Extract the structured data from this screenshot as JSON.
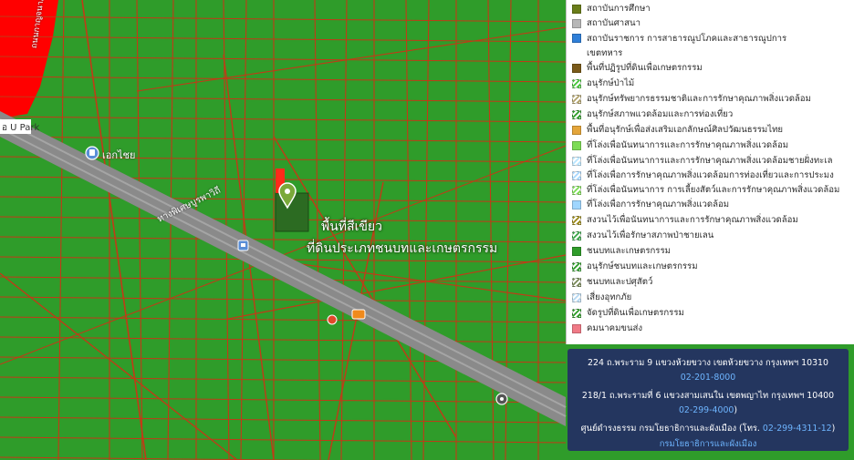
{
  "map": {
    "place_labels": {
      "park": "อ U Park",
      "poi": "เอกไชย",
      "road_main": "ทางพิเศษบูรพาวิถี",
      "road_side": "ถนนกาญจนาภิเษก"
    },
    "parcel_title": "พื้นที่สีเขียว",
    "parcel_subtitle": "ที่ดินประเภทชนบทและเกษตรกรรม",
    "colors": {
      "rural_agri": "#2f9c2a",
      "commercial": "#ff0000",
      "road": "#8a8a8a",
      "parcel_lines": "#c23a17",
      "selected_parcel": "#2c6b22"
    }
  },
  "legend": {
    "items": [
      {
        "label": "สถาบันการศึกษา",
        "color": "#6a7d1a",
        "pattern": "solid"
      },
      {
        "label": "สถาบันศาสนา",
        "color": "#b7b7b7",
        "pattern": "solid"
      },
      {
        "label": "สถาบันราชการ การสาธารณูปโภคและสาธารณูปการ เขตทหาร",
        "color": "#2f7fd8",
        "pattern": "solid"
      },
      {
        "label": "พื้นที่ปฏิรูปที่ดินเพื่อเกษตรกรรม",
        "color": "#7a5a1a",
        "pattern": "solid"
      },
      {
        "label": "อนุรักษ์ป่าไม้",
        "color": "#45c43a",
        "pattern": "hatch"
      },
      {
        "label": "อนุรักษ์ทรัพยากรธรรมชาติและการรักษาคุณภาพสิ่งแวดล้อม",
        "color": "#b2a36d",
        "pattern": "hatch"
      },
      {
        "label": "อนุรักษ์สภาพแวดล้อมและการท่องเที่ยว",
        "color": "#2f9c2a",
        "pattern": "hatch"
      },
      {
        "label": "พื้นที่อนุรักษ์เพื่อส่งเสริมเอกลักษณ์ศิลปวัฒนธรรมไทย",
        "color": "#e4a53a",
        "pattern": "solid"
      },
      {
        "label": "ที่โล่งเพื่อนันทนาการและการรักษาคุณภาพสิ่งแวดล้อม",
        "color": "#7ddc55",
        "pattern": "solid"
      },
      {
        "label": "ที่โล่งเพื่อนันทนาการและการรักษาคุณภาพสิ่งแวดล้อมชายฝั่งทะเล",
        "color": "#b9e6ff",
        "pattern": "hatch"
      },
      {
        "label": "ที่โล่งเพื่อการรักษาคุณภาพสิ่งแวดล้อมการท่องเที่ยวและการประมง",
        "color": "#a8d8ff",
        "pattern": "hatch"
      },
      {
        "label": "ที่โล่งเพื่อนันทนาการ การเลี้ยงสัตว์และการรักษาคุณภาพสิ่งแวดล้อม",
        "color": "#7ddc55",
        "pattern": "hatch"
      },
      {
        "label": "ที่โล่งเพื่อการรักษาคุณภาพสิ่งแวดล้อม",
        "color": "#9fd6ff",
        "pattern": "solid"
      },
      {
        "label": "สงวนไว้เพื่อนันทนาการและการรักษาคุณภาพสิ่งแวดล้อม",
        "color": "#9b8a1c",
        "pattern": "hatch"
      },
      {
        "label": "สงวนไว้เพื่อรักษาสภาพป่าชายเลน",
        "color": "#3aa64a",
        "pattern": "hatch"
      },
      {
        "label": "ชนบทและเกษตรกรรม",
        "color": "#2f9c2a",
        "pattern": "solid"
      },
      {
        "label": "อนุรักษ์ชนบทและเกษตรกรรม",
        "color": "#2f9c2a",
        "pattern": "hatch"
      },
      {
        "label": "ชนบทและปศุสัตว์",
        "color": "#7a8a5a",
        "pattern": "hatch"
      },
      {
        "label": "เสี่ยงอุทกภัย",
        "color": "#b7d9f2",
        "pattern": "hatch"
      },
      {
        "label": "จัดรูปที่ดินเพื่อเกษตรกรรม",
        "color": "#2f9c2a",
        "pattern": "hatch"
      },
      {
        "label": "คมนาคมขนส่ง",
        "color": "#f07a86",
        "pattern": "solid"
      }
    ]
  },
  "contact": {
    "line1": "224 ถ.พระราม 9 แขวงห้วยขวาง เขตห้วยขวาง กรุงเทพฯ 10310",
    "phone1": "02-201-8000",
    "line2": "218/1 ถ.พระรามที่ 6 แขวงสามเสนใน เขตพญาไท กรุงเทพฯ 10400",
    "phone2": "02-299-4000",
    "phone2_suffix": ")",
    "line3": "ศูนย์ดำรงธรรม กรมโยธาธิการและผังเมือง (โทร.",
    "phone3": "02-299-4311-12",
    "phone3_suffix": ")",
    "dept_link": "กรมโยธาธิการและผังเมือง"
  }
}
